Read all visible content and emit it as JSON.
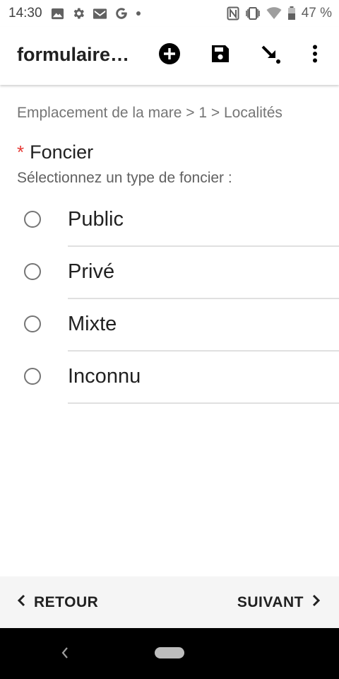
{
  "status_bar": {
    "time": "14:30",
    "left_icons": [
      "image-icon",
      "gear-icon",
      "gmail-icon",
      "google-icon",
      "dot-icon"
    ],
    "right_icons": [
      "nfc-icon",
      "vibrate-icon",
      "wifi-icon",
      "battery-icon"
    ],
    "battery": "47 %"
  },
  "app_bar": {
    "title": "formulaire…",
    "actions": [
      "add-circle-icon",
      "save-icon",
      "jump-icon",
      "more-vert-icon"
    ]
  },
  "breadcrumb": "Emplacement de la mare > 1 > Localités",
  "question": {
    "required_mark": "*",
    "title": "Foncier",
    "hint": "Sélectionnez un type de foncier :",
    "options": [
      {
        "label": "Public",
        "selected": false
      },
      {
        "label": "Privé",
        "selected": false
      },
      {
        "label": "Mixte",
        "selected": false
      },
      {
        "label": "Inconnu",
        "selected": false
      }
    ]
  },
  "navigation": {
    "back_label": "RETOUR",
    "next_label": "SUIVANT"
  },
  "colors": {
    "required": "#e53935",
    "bottom_nav_bg": "#f5f5f5",
    "system_nav_bg": "#000000"
  }
}
